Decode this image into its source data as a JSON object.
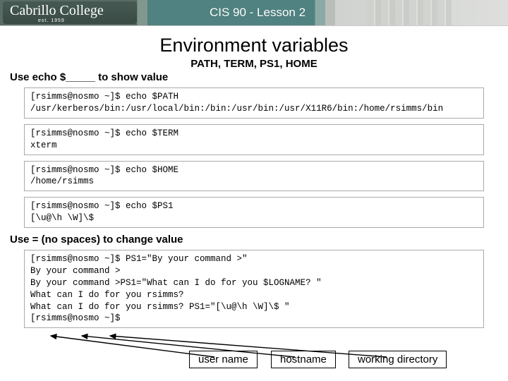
{
  "banner": {
    "logo_main": "Cabrillo College",
    "logo_sub": "est. 1959",
    "title": "CIS 90 - Lesson 2"
  },
  "heading": {
    "title": "Environment variables",
    "subtitle": "PATH, TERM, PS1, HOME"
  },
  "instruction1": "Use echo $_____ to show value",
  "term1": "[rsimms@nosmo ~]$ echo $PATH\n/usr/kerberos/bin:/usr/local/bin:/bin:/usr/bin:/usr/X11R6/bin:/home/rsimms/bin",
  "term2": "[rsimms@nosmo ~]$ echo $TERM\nxterm",
  "term3": "[rsimms@nosmo ~]$ echo $HOME\n/home/rsimms",
  "term4": "[rsimms@nosmo ~]$ echo $PS1\n[\\u@\\h \\W]\\$",
  "instruction2": "Use = (no spaces) to change value",
  "term5": "[rsimms@nosmo ~]$ PS1=\"By your command >\"\nBy your command >\nBy your command >PS1=\"What can I do for you $LOGNAME? \"\nWhat can I do for you rsimms?\nWhat can I do for you rsimms? PS1=\"[\\u@\\h \\W]\\$ \"\n[rsimms@nosmo ~]$",
  "labels": {
    "user": "user name",
    "host": "hostname",
    "wd": "working directory"
  }
}
